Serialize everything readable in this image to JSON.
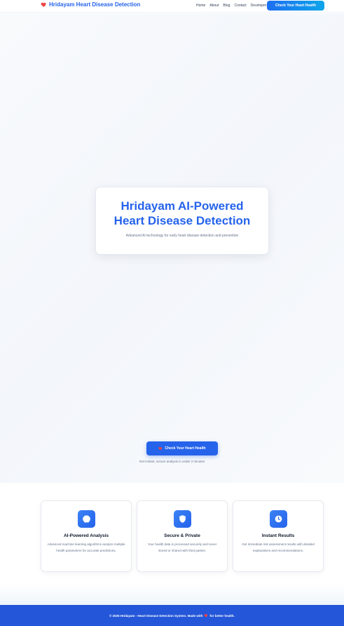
{
  "colors": {
    "accent": "#2563eb",
    "footer": "#2356d8",
    "heart": "#ef4444"
  },
  "navbar": {
    "brand_icon": "heart-icon",
    "brand_text": "Hridayam Heart Disease Detection",
    "links": [
      "Home",
      "About",
      "Blog",
      "Contact",
      "Developer"
    ],
    "cta_label": "Check Your Heart Health"
  },
  "hero": {
    "title_line1": "Hridayam AI-Powered",
    "title_line2": "Heart Disease Detection",
    "subtitle": "Advanced AI technology for early heart disease detection and prevention",
    "cta_icon": "heart-icon",
    "cta_label": "Check Your Heart Health",
    "note": "Get instant, secure analysis in under 2 minutes"
  },
  "features": [
    {
      "icon": "brain-icon",
      "title": "AI-Powered Analysis",
      "description": "Advanced machine learning algorithms analyze multiple health parameters for accurate predictions."
    },
    {
      "icon": "shield-icon",
      "title": "Secure & Private",
      "description": "Your health data is processed securely and never stored or shared with third parties."
    },
    {
      "icon": "clock-icon",
      "title": "Instant Results",
      "description": "Get immediate risk assessment results with detailed explanations and recommendations."
    }
  ],
  "footer": {
    "text_before": "© 2025 Hridayam - Heart Disease Detection System. Made with",
    "heart_icon": "heart-icon",
    "text_after": "for better health."
  }
}
